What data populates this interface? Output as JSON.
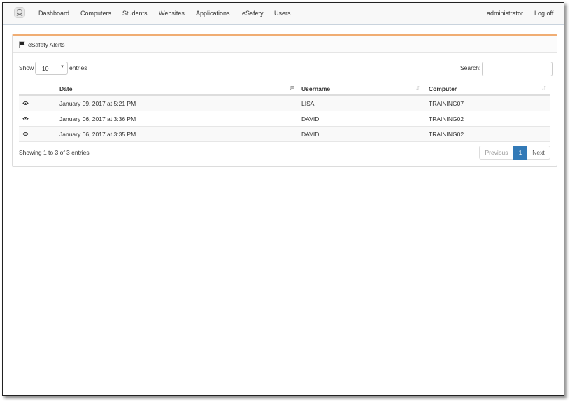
{
  "nav": {
    "items": [
      "Dashboard",
      "Computers",
      "Students",
      "Websites",
      "Applications",
      "eSafety",
      "Users"
    ],
    "user": "administrator",
    "logoff": "Log off"
  },
  "panel": {
    "title": "eSafety Alerts"
  },
  "controls": {
    "show_label": "Show",
    "entries_value": "10",
    "entries_label": "entries",
    "search_label": "Search:",
    "search_value": ""
  },
  "table": {
    "columns": [
      "Date",
      "Username",
      "Computer"
    ],
    "rows": [
      {
        "date": "January 09, 2017 at 5:21 PM",
        "username": "LISA",
        "computer": "TRAINING07"
      },
      {
        "date": "January 06, 2017 at 3:36 PM",
        "username": "DAVID",
        "computer": "TRAINING02"
      },
      {
        "date": "January 06, 2017 at 3:35 PM",
        "username": "DAVID",
        "computer": "TRAINING02"
      }
    ]
  },
  "footer": {
    "info": "Showing 1 to 3 of 3 entries",
    "previous": "Previous",
    "current_page": "1",
    "next": "Next"
  }
}
